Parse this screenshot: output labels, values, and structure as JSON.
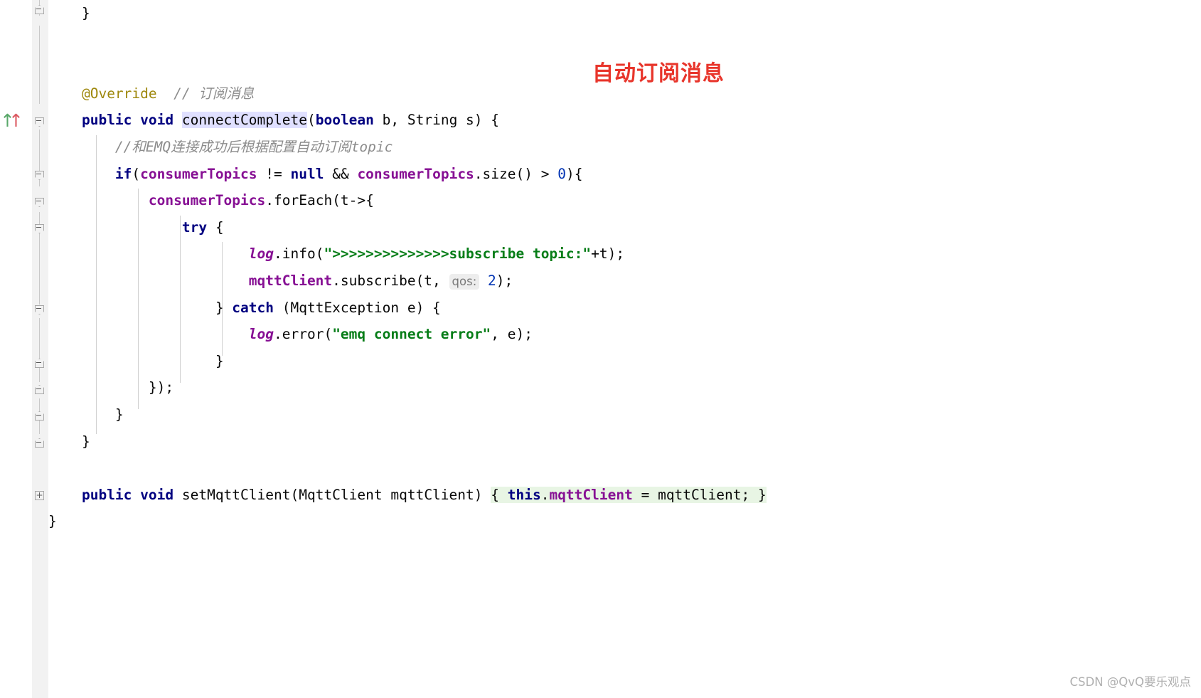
{
  "editor": {
    "language": "Java",
    "font_size_px": 19.5,
    "background": "#ffffff",
    "gutter_background": "#f2f2f2"
  },
  "colors": {
    "keyword": "#000080",
    "field": "#871094",
    "string": "#067D17",
    "number": "#0033B3",
    "comment": "#8C8C8C",
    "annotation": "#9E880D",
    "selection_highlight": "#E0E0FF",
    "green_highlight": "#E8F5E4",
    "inlay_background": "#EDEDED",
    "inlay_text": "#7a7a7a",
    "red_note": "#E8352B",
    "watermark": "#b0b0b0"
  },
  "annotation_overlay": {
    "text": "自动订阅消息"
  },
  "watermark": {
    "text": "CSDN @QvQ要乐观点"
  },
  "vcs_marker": {
    "green_arrow": "↑",
    "red_arrow": "↑"
  },
  "gutter": {
    "markers": [
      {
        "type": "fold-up",
        "name": "fold-marker-collapse"
      },
      {
        "type": "fold-down",
        "name": "fold-marker-expand"
      },
      {
        "type": "fold-down",
        "name": "fold-marker-expand"
      },
      {
        "type": "fold-down",
        "name": "fold-marker-expand"
      },
      {
        "type": "fold-down",
        "name": "fold-marker-expand"
      },
      {
        "type": "fold-up",
        "name": "fold-marker-collapse"
      },
      {
        "type": "fold-up",
        "name": "fold-marker-collapse"
      },
      {
        "type": "fold-up",
        "name": "fold-marker-collapse"
      },
      {
        "type": "fold-up",
        "name": "fold-marker-collapse"
      },
      {
        "type": "fold-plus",
        "name": "fold-marker-plus"
      }
    ]
  },
  "code": {
    "lines": [
      {
        "id": "line-close-brace-1",
        "indent": 1,
        "tokens": [
          {
            "t": "}",
            "c": "plain"
          }
        ]
      },
      {
        "id": "line-blank-1",
        "indent": 0,
        "tokens": []
      },
      {
        "id": "line-blank-2",
        "indent": 0,
        "tokens": []
      },
      {
        "id": "line-override",
        "indent": 1,
        "tokens": [
          {
            "t": "@Override",
            "c": "anno"
          },
          {
            "t": "  ",
            "c": "plain"
          },
          {
            "t": "// 订阅消息",
            "c": "cmt"
          }
        ]
      },
      {
        "id": "line-method-signature",
        "indent": 1,
        "tokens": [
          {
            "t": "public void ",
            "c": "kw"
          },
          {
            "t": "connectComplete",
            "c": "sel-method"
          },
          {
            "t": "(",
            "c": "plain"
          },
          {
            "t": "boolean",
            "c": "kw"
          },
          {
            "t": " b, String s) {",
            "c": "plain"
          }
        ]
      },
      {
        "id": "line-comment-emq",
        "indent": 2,
        "tokens": [
          {
            "t": "//和EMQ连接成功后根据配置自动订阅topic",
            "c": "cmt"
          }
        ]
      },
      {
        "id": "line-if-consumertopics",
        "indent": 2,
        "tokens": [
          {
            "t": "if",
            "c": "kw"
          },
          {
            "t": "(",
            "c": "plain"
          },
          {
            "t": "consumerTopics",
            "c": "field"
          },
          {
            "t": " != ",
            "c": "plain"
          },
          {
            "t": "null",
            "c": "kw"
          },
          {
            "t": " && ",
            "c": "plain"
          },
          {
            "t": "consumerTopics",
            "c": "field"
          },
          {
            "t": ".size() > ",
            "c": "plain"
          },
          {
            "t": "0",
            "c": "num"
          },
          {
            "t": "){",
            "c": "plain"
          }
        ]
      },
      {
        "id": "line-foreach",
        "indent": 3,
        "tokens": [
          {
            "t": "consumerTopics",
            "c": "field"
          },
          {
            "t": ".forEach(t->{",
            "c": "plain"
          }
        ]
      },
      {
        "id": "line-try",
        "indent": 4,
        "tokens": [
          {
            "t": "try",
            "c": "kw"
          },
          {
            "t": " {",
            "c": "plain"
          }
        ]
      },
      {
        "id": "line-log-info",
        "indent": 6,
        "tokens": [
          {
            "t": "log",
            "c": "logvar"
          },
          {
            "t": ".info(",
            "c": "plain"
          },
          {
            "t": "\">>>>>>>>>>>>>>subscribe topic:\"",
            "c": "str"
          },
          {
            "t": "+t);",
            "c": "plain"
          }
        ]
      },
      {
        "id": "line-subscribe",
        "indent": 6,
        "tokens": [
          {
            "t": "mqttClient",
            "c": "field"
          },
          {
            "t": ".subscribe(t, ",
            "c": "plain"
          },
          {
            "t": "qos:",
            "c": "inlay"
          },
          {
            "t": " ",
            "c": "plain"
          },
          {
            "t": "2",
            "c": "num"
          },
          {
            "t": ");",
            "c": "plain"
          }
        ]
      },
      {
        "id": "line-catch",
        "indent": 5,
        "tokens": [
          {
            "t": "} ",
            "c": "plain"
          },
          {
            "t": "catch",
            "c": "kw"
          },
          {
            "t": " (MqttException e) {",
            "c": "plain"
          }
        ]
      },
      {
        "id": "line-log-error",
        "indent": 6,
        "tokens": [
          {
            "t": "log",
            "c": "logvar"
          },
          {
            "t": ".error(",
            "c": "plain"
          },
          {
            "t": "\"emq connect error\"",
            "c": "str"
          },
          {
            "t": ", e);",
            "c": "plain"
          }
        ]
      },
      {
        "id": "line-close-try",
        "indent": 5,
        "tokens": [
          {
            "t": "}",
            "c": "plain"
          }
        ]
      },
      {
        "id": "line-close-foreach",
        "indent": 3,
        "tokens": [
          {
            "t": "});",
            "c": "plain"
          }
        ]
      },
      {
        "id": "line-close-if",
        "indent": 2,
        "tokens": [
          {
            "t": "}",
            "c": "plain"
          }
        ]
      },
      {
        "id": "line-close-method",
        "indent": 1,
        "tokens": [
          {
            "t": "}",
            "c": "plain"
          }
        ]
      },
      {
        "id": "line-blank-3",
        "indent": 0,
        "tokens": []
      },
      {
        "id": "line-setter",
        "indent": 1,
        "tokens": [
          {
            "t": "public void ",
            "c": "kw"
          },
          {
            "t": "setMqttClient(MqttClient mqttClient) ",
            "c": "plain"
          },
          {
            "t": "{ ",
            "c": "hl-green"
          },
          {
            "t": "this",
            "c": "kw-green"
          },
          {
            "t": ".",
            "c": "green-plain"
          },
          {
            "t": "mqttClient",
            "c": "field-green"
          },
          {
            "t": " = mqttClient; ",
            "c": "green-plain"
          },
          {
            "t": "}",
            "c": "hl-green"
          }
        ]
      },
      {
        "id": "line-close-class",
        "indent": 0,
        "tokens": [
          {
            "t": "}",
            "c": "plain"
          }
        ]
      }
    ]
  }
}
